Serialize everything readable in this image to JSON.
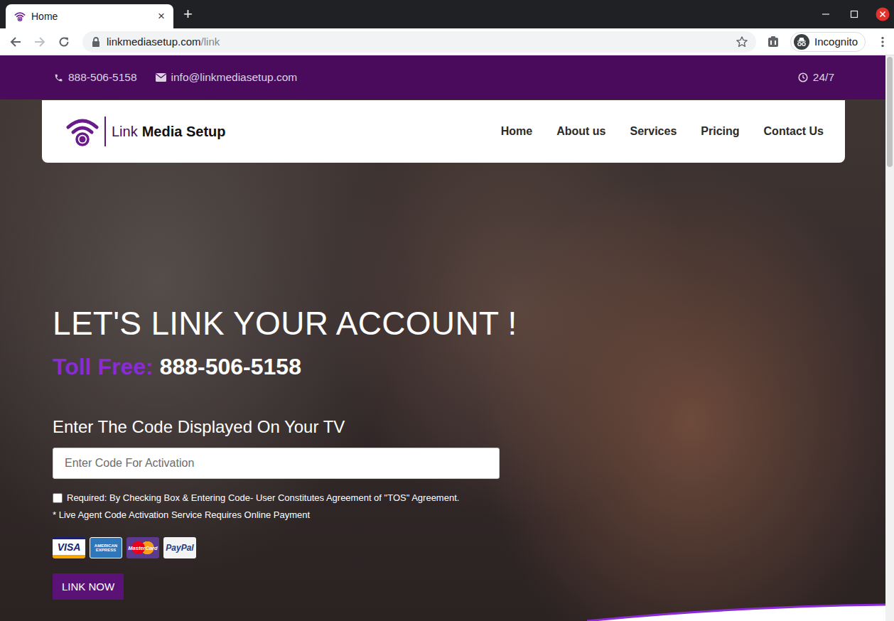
{
  "window": {
    "tab": {
      "label": "Home",
      "selected": true
    },
    "tab_close": "×",
    "new_tab": "+"
  },
  "toolbar": {
    "url_host": "linkmediasetup.com",
    "url_path": "/link",
    "bookmarked": false,
    "profile": "Incognito"
  },
  "topbar": {
    "phone": "888-506-5158",
    "email": "info@linkmediasetup.com",
    "hours": "24/7"
  },
  "brand": {
    "light": "Link",
    "bold": "Media Setup"
  },
  "nav": [
    {
      "label": "Home"
    },
    {
      "label": "About us"
    },
    {
      "label": "Services"
    },
    {
      "label": "Pricing"
    },
    {
      "label": "Contact Us"
    }
  ],
  "hero": {
    "heading": "LET'S LINK YOUR ACCOUNT !",
    "tollfree_label": "Toll Free:",
    "tollfree_number": "888-506-5158",
    "prompt": "Enter The Code Displayed On Your TV",
    "code_placeholder": "Enter Code For Activation",
    "agreement": {
      "label": "Required: By Checking Box & Entering Code- User Constitutes Agreement of \"TOS\" Agreement.",
      "checked": false
    },
    "note": "* Live Agent Code Activation Service Requires Online Payment",
    "payments": [
      {
        "label": "VISA",
        "kind": "visa"
      },
      {
        "label": "AMERICAN EXPRESS",
        "kind": "amex"
      },
      {
        "label": "MasterCard",
        "kind": "mastercard"
      },
      {
        "label": "PayPal",
        "kind": "paypal"
      }
    ],
    "button": "LINK NOW"
  }
}
